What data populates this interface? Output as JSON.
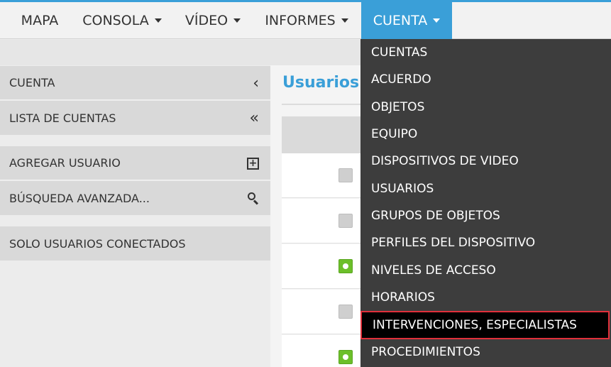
{
  "nav": {
    "items": [
      {
        "label": "MAPA",
        "has_caret": false
      },
      {
        "label": "CONSOLA",
        "has_caret": true
      },
      {
        "label": "VÍDEO",
        "has_caret": true
      },
      {
        "label": "INFORMES",
        "has_caret": true
      },
      {
        "label": "CUENTA",
        "has_caret": true,
        "active": true
      }
    ]
  },
  "sidebar": {
    "items": [
      {
        "label": "CUENTA",
        "icon": "chevron-left-icon",
        "glyph": "‹"
      },
      {
        "label": "LISTA DE CUENTAS",
        "icon": "double-chevron-left-icon",
        "glyph": "«"
      },
      {
        "label": "AGREGAR USUARIO",
        "icon": "plus-box-icon"
      },
      {
        "label": "BÚSQUEDA AVANZADA...",
        "icon": "search-icon"
      },
      {
        "label": "SOLO USUARIOS CONECTADOS"
      }
    ]
  },
  "main": {
    "title": "Usuarios",
    "rows": [
      {
        "status": "off"
      },
      {
        "status": "off"
      },
      {
        "status": "on"
      },
      {
        "status": "off"
      },
      {
        "status": "on"
      }
    ]
  },
  "dropdown": {
    "items": [
      {
        "label": "CUENTAS"
      },
      {
        "label": "ACUERDO"
      },
      {
        "label": "OBJETOS"
      },
      {
        "label": "EQUIPO"
      },
      {
        "label": "DISPOSITIVOS DE VIDEO"
      },
      {
        "label": "USUARIOS"
      },
      {
        "label": "GRUPOS DE OBJETOS"
      },
      {
        "label": "PERFILES DEL DISPOSITIVO"
      },
      {
        "label": "NIVELES DE ACCESO"
      },
      {
        "label": "HORARIOS"
      },
      {
        "label": "INTERVENCIONES, ESPECIALISTAS",
        "highlighted": true
      },
      {
        "label": "PROCEDIMIENTOS"
      }
    ]
  },
  "colors": {
    "accent": "#3a9fd8",
    "highlight_border": "#e0303b",
    "dropdown_bg": "#3d3d3d",
    "online_green": "#6cbf2a"
  }
}
